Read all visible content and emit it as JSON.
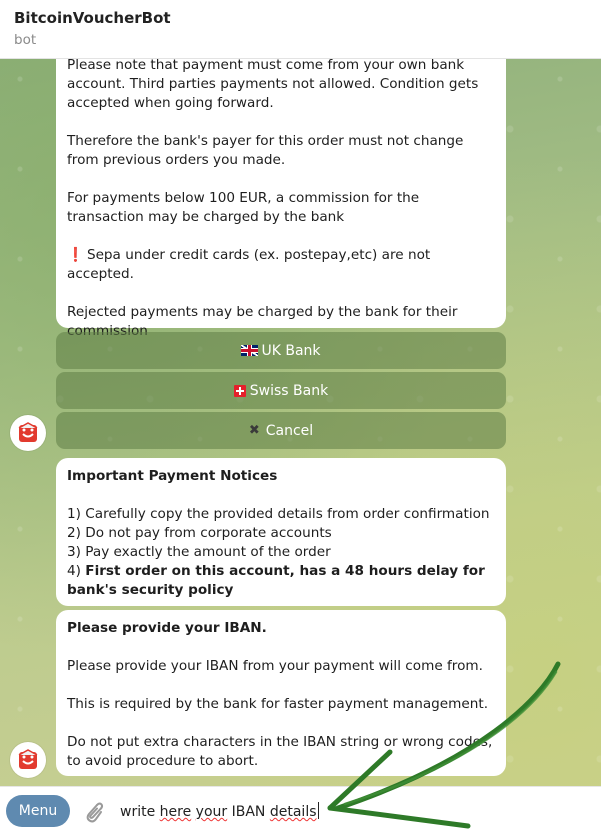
{
  "header": {
    "title": "BitcoinVoucherBot",
    "subtitle": "bot"
  },
  "message1": {
    "p1": "Please note that payment must come from your own bank account. Third parties payments not allowed. Condition gets accepted when going forward.",
    "p2": "Therefore the bank's payer for this order must not change from previous orders you made.",
    "p3": "For payments below 100 EUR, a commission for the transaction may be charged by the bank",
    "p4_mark": "❗",
    "p4": "Sepa under credit cards (ex. postepay,etc) are not accepted.",
    "p5": "Rejected payments may be charged by the bank for their commission"
  },
  "keyboard": {
    "uk": "UK Bank",
    "swiss": "Swiss Bank",
    "cancel_icon": "✖",
    "cancel": "Cancel"
  },
  "message2": {
    "heading": "Important Payment Notices",
    "l1": "1) Carefully copy the provided details from order confirmation",
    "l2": "2) Do not pay from corporate accounts",
    "l3": "3) Pay exactly the amount of the order",
    "l4_prefix": "4) ",
    "l4_bold": "First order on this account, has a 48 hours delay for bank's security policy"
  },
  "message3": {
    "heading": "Please provide your IBAN.",
    "p1": "Please provide your IBAN from your payment will come from.",
    "p2": "This is required by the bank for faster payment management.",
    "p3": "Do not put extra characters in the IBAN string or wrong codes, to avoid procedure to abort."
  },
  "input": {
    "menu": "Menu",
    "w1": "write",
    "w2": "here",
    "w3": "your",
    "w4": "IBAN",
    "w5": "details"
  },
  "colors": {
    "menu_button": "#5f8ab0",
    "keyboard_button": "#6a8650",
    "arrow": "#2e7a28",
    "chat_bg": "#a6bf86"
  },
  "icons": [
    "uk-flag-icon",
    "swiss-flag-icon",
    "close-icon",
    "bot-avatar-icon",
    "paperclip-icon",
    "exclamation-icon"
  ]
}
